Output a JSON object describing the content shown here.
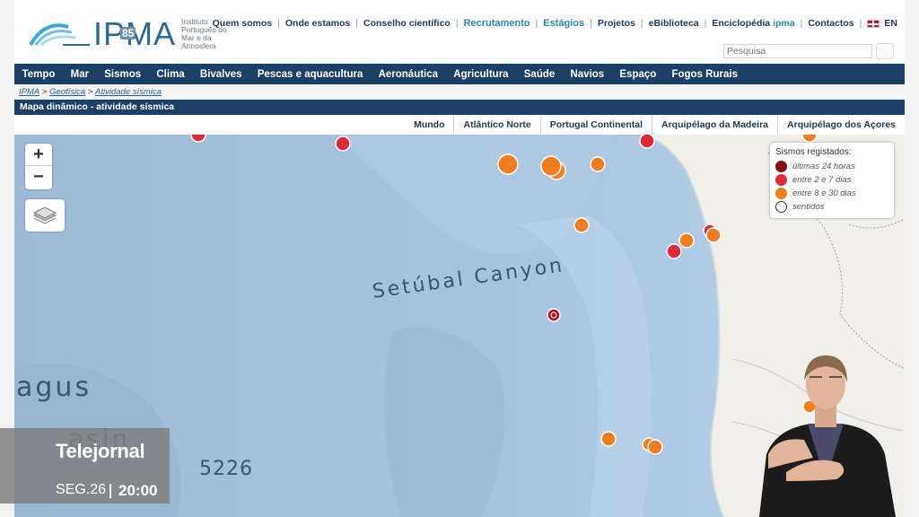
{
  "header": {
    "logo_text": "IPMA",
    "logo_years": "85",
    "logo_subtitle": "Instituto Português do Mar e da Atmosfera",
    "top_links": [
      "Quem somos",
      "Onde estamos",
      "Conselho científico",
      "Recrutamento",
      "Estágios",
      "Projetos",
      "eBiblioteca",
      "Enciclopédia",
      "Contactos"
    ],
    "encyclopedia_brand": "ipma",
    "language": "EN",
    "search_placeholder": "Pesquisa"
  },
  "main_nav": [
    "Tempo",
    "Mar",
    "Sismos",
    "Clima",
    "Bivalves",
    "Pescas e aquacultura",
    "Aeronáutica",
    "Agricultura",
    "Saúde",
    "Navios",
    "Espaço",
    "Fogos Rurais"
  ],
  "breadcrumb": {
    "items": [
      "IPMA",
      "Geofísica",
      "Atividade sísmica"
    ],
    "separator": " > "
  },
  "section_title": "Mapa dinâmico - atividade sísmica",
  "region_tabs": [
    "Mundo",
    "Atlântico Norte",
    "Portugal Continental",
    "Arquipélago da Madeira",
    "Arquipélago dos Açores"
  ],
  "map": {
    "zoom_in": "+",
    "zoom_out": "−",
    "labels": [
      "Setúbal Canyon",
      "agus",
      "asin",
      "5226"
    ],
    "legend": {
      "title": "Sismos registados:",
      "entries": [
        {
          "label": "últimas 24 horas",
          "color": "#8b0e0e"
        },
        {
          "label": "entre 2 e 7 dias",
          "color": "#e02a3a"
        },
        {
          "label": "entre 8 e 30 dias",
          "color": "#f07d1e"
        },
        {
          "label": "sentidos",
          "color": "#ffffff"
        }
      ]
    }
  },
  "tv_overlay": {
    "program": "Telejornal",
    "date": "SEG.26",
    "time": "20:00"
  },
  "colors": {
    "nav_bg": "#1b3f66",
    "ocean": "#a9c4dc",
    "land": "#f1efe9",
    "quake_recent": "#8b0e0e",
    "quake_week": "#e02a3a",
    "quake_month": "#f07d1e"
  }
}
